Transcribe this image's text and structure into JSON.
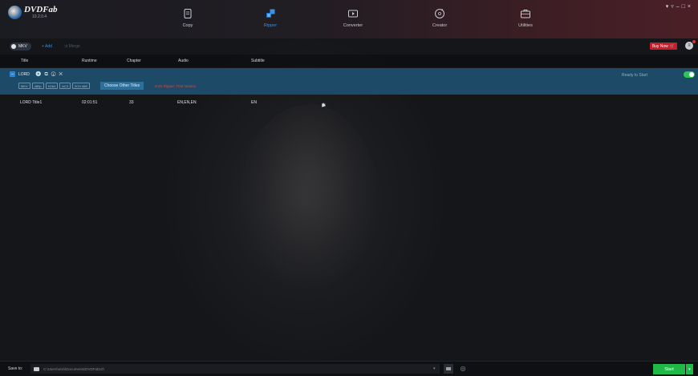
{
  "app": {
    "name": "DVDFab",
    "version": "10.2.0.4"
  },
  "window_controls": [
    "▾",
    "▿",
    "–",
    "□",
    "×"
  ],
  "nav": {
    "tabs": [
      {
        "label": "Copy",
        "icon": "copy-icon",
        "active": false
      },
      {
        "label": "Ripper",
        "icon": "ripper-icon",
        "active": true
      },
      {
        "label": "Converter",
        "icon": "converter-icon",
        "active": false
      },
      {
        "label": "Creator",
        "icon": "creator-icon",
        "active": false
      },
      {
        "label": "Utilities",
        "icon": "utilities-icon",
        "active": false
      }
    ],
    "active_color": "#3b8fe6"
  },
  "toolbar": {
    "profile": "MKV",
    "add_label": "Add",
    "merge_label": "Merge",
    "buy_now": "Buy Now",
    "buy_color": "#c41e2a"
  },
  "columns": [
    "Title",
    "Runtime",
    "Chapter",
    "Audio",
    "Subtitle"
  ],
  "source": {
    "name": "LORD",
    "type_icon": "dvd-icon",
    "tags": [
      "MKV",
      "480p",
      "H264",
      "AC3",
      "2CH 48K"
    ],
    "choose_label": "Choose Other Titles",
    "note": "DVD Ripper: Trial Version",
    "status": "Ready to Start",
    "bg_color": "#1d4a66",
    "toggle_on": true
  },
  "titles": [
    {
      "title": "LORD Title1",
      "runtime": "02:01:51",
      "chapter": "33",
      "audio": "EN,EN,EN",
      "subtitle": "EN"
    }
  ],
  "bottom": {
    "save_to_label": "Save to:",
    "path": "C:\\Users\\nish\\Documents\\DVDFab10\\",
    "start_label": "Start",
    "start_color": "#1fb948"
  }
}
